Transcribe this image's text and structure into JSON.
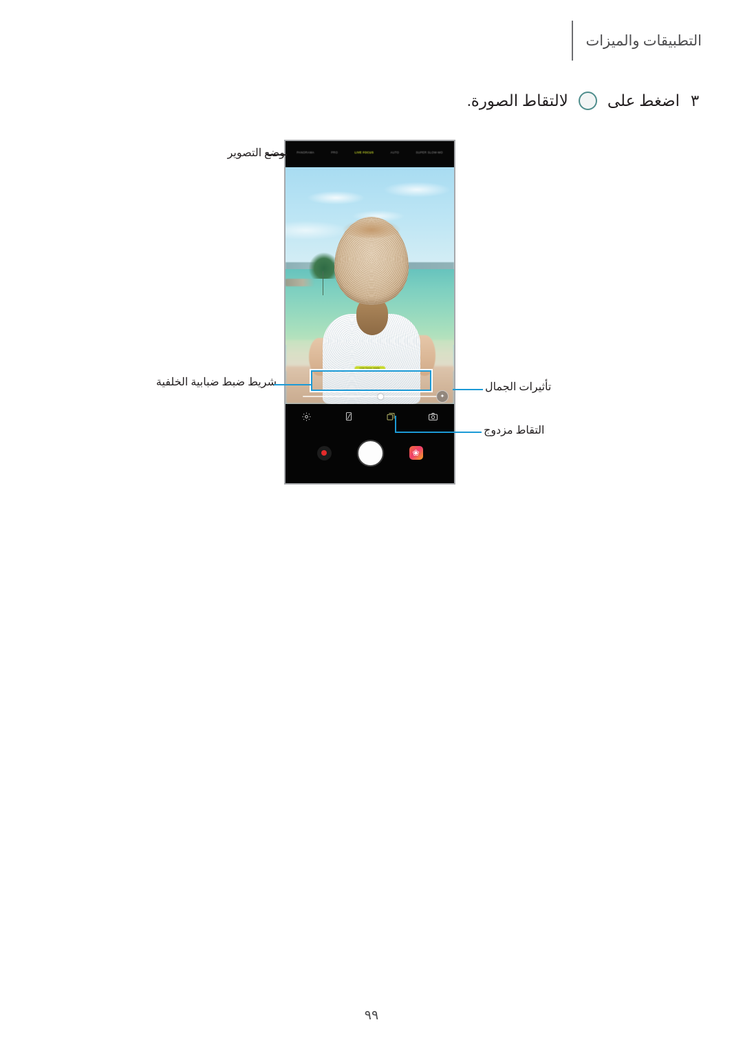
{
  "header": {
    "title": "التطبيقات والميزات"
  },
  "step": {
    "number": "٣",
    "text_before": "اضغط على",
    "text_after": "لالتقاط الصورة.",
    "shutter_icon": "shutter-circle-icon"
  },
  "phone": {
    "camera": {
      "mode_tabs": [
        {
          "label": "PANORAMA",
          "active": false
        },
        {
          "label": "PRO",
          "active": false
        },
        {
          "label": "LIVE FOCUS",
          "active": true
        },
        {
          "label": "AUTO",
          "active": false
        },
        {
          "label": "SUPER SLOW-MO",
          "active": false
        }
      ],
      "viewfinder": {
        "scene_description": "امرأة بقبعة من القش على شاطئ استوائي",
        "focus_badge": "Live focus ready"
      },
      "blur_slider": {
        "name": "blur-intensity-slider",
        "value_percent": 58
      },
      "beauty_button": {
        "icon": "sparkle-icon"
      },
      "toolbar": [
        {
          "name": "settings-icon",
          "label": "الإعدادات",
          "active": false
        },
        {
          "name": "aspect-ratio-icon",
          "label": "نسبة العرض إلى الارتفاع",
          "active": false
        },
        {
          "name": "dual-capture-icon",
          "label": "التقاط مزدوج",
          "active": true
        },
        {
          "name": "camera-filter-icon",
          "label": "المرشحات",
          "active": false
        }
      ],
      "controls": [
        {
          "name": "record-button",
          "label": "تسجيل"
        },
        {
          "name": "shutter-button",
          "label": "التقاط"
        },
        {
          "name": "gallery-thumbnail-button",
          "label": "المعرض"
        }
      ]
    }
  },
  "callouts": {
    "shooting_mode": "وضع التصوير",
    "blur_slider": "شريط ضبط ضبابية الخلفية",
    "beauty_effects": "تأثيرات الجمال",
    "dual_capture": "التقاط مزدوج"
  },
  "footer": {
    "page_number": "٩٩"
  },
  "colors": {
    "accent_leader": "#1c9ad6",
    "active_tab": "#cfe02a",
    "focus_badge": "#c8d92a",
    "record_red": "#e52b2b",
    "text": "#231f20",
    "header_text": "#4d4d4f"
  }
}
